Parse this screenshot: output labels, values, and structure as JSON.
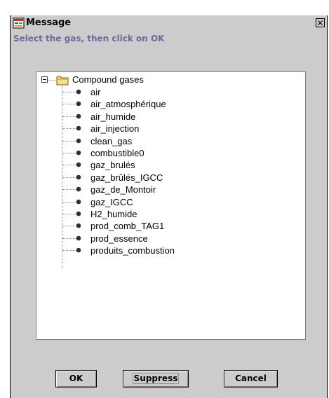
{
  "window": {
    "title": "Message",
    "close_glyph": "✕"
  },
  "instruction": "Select the gas, then click on OK",
  "tree": {
    "root": {
      "label": "Compound gases",
      "expanded": true,
      "icon": "folder-icon"
    },
    "items": [
      "air",
      "air_atmosphérique",
      "air_humide",
      "air_injection",
      "clean_gas",
      "combustible0",
      "gaz_brulés",
      "gaz_brûlés_IGCC",
      "gaz_de_Montoir",
      "gaz_IGCC",
      "H2_humide",
      "prod_comb_TAG1",
      "prod_essence",
      "produits_combustion"
    ]
  },
  "buttons": {
    "ok": "OK",
    "suppress": "Suppress",
    "cancel": "Cancel"
  },
  "colors": {
    "window_bg": "#cccccc",
    "instruction_text": "#6a6aa0",
    "tree_bg": "#ffffff",
    "focus_outline": "#8c8cc8",
    "folder_fill": "#f0d070"
  }
}
